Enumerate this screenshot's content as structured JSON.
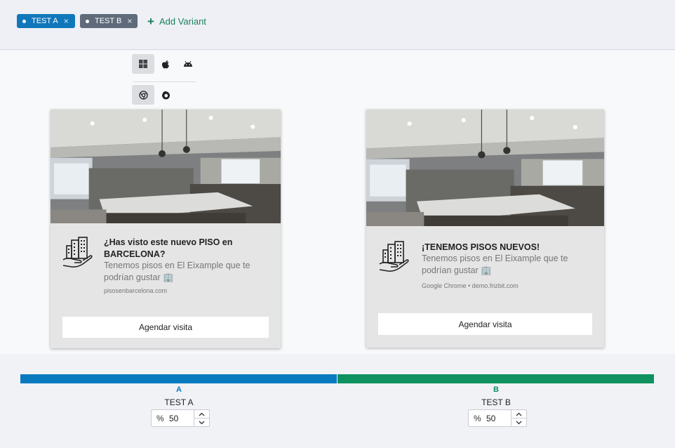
{
  "variants_bar": {
    "tags": [
      {
        "label": "TEST A",
        "close": "×",
        "color": "#1177bb"
      },
      {
        "label": "TEST B",
        "close": "×",
        "color": "#5f6b7a"
      }
    ],
    "add_variant_icon": "+",
    "add_variant_label": "Add Variant"
  },
  "platform_selector": {
    "os": [
      "windows-icon",
      "apple-icon",
      "android-icon"
    ],
    "selected_os": "windows-icon",
    "browsers": [
      "chrome-icon",
      "firefox-icon"
    ],
    "selected_browser": "chrome-icon"
  },
  "previews": [
    {
      "variant": "A",
      "title": "¿Has visto este nuevo PISO en BARCELONA?",
      "body": "Tenemos pisos en El Eixample que te podrían gustar 🏢",
      "source": "pisosenbarcelona.com",
      "button_label": "Agendar visita"
    },
    {
      "variant": "B",
      "title": "¡TENEMOS PISOS NUEVOS!",
      "body": "Tenemos pisos en El Eixample que te podrían gustar 🏢",
      "source": "Google Chrome • demo.frizbit.com",
      "button_label": "Agendar visita"
    }
  ],
  "split": {
    "a": {
      "letter": "A",
      "name": "TEST A",
      "percent_symbol": "%",
      "value": "50",
      "share": 0.5,
      "color": "#0a7abf"
    },
    "b": {
      "letter": "B",
      "name": "TEST B",
      "percent_symbol": "%",
      "value": "50",
      "share": 0.5,
      "color": "#0f9160"
    }
  }
}
